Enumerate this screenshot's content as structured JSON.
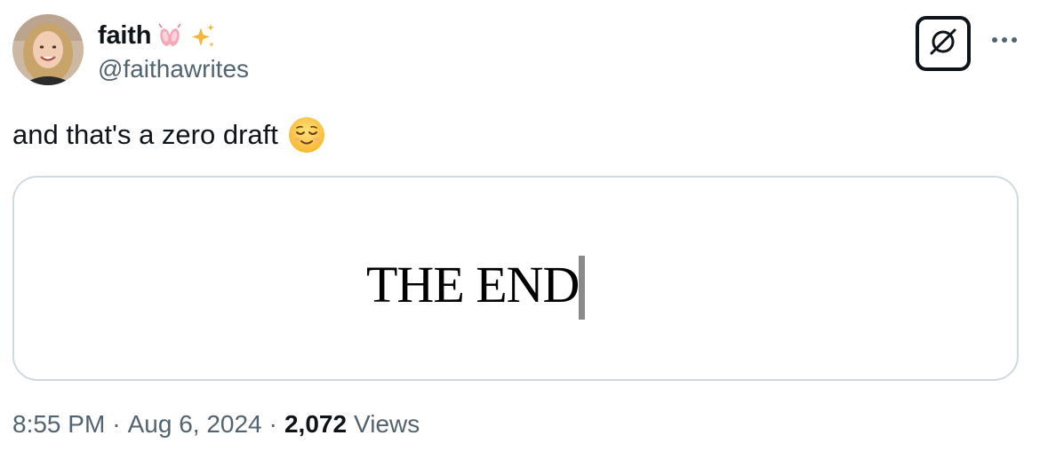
{
  "author": {
    "display_name": "faith",
    "handle": "@faithawrites",
    "name_emojis": [
      "ballet-shoes-icon",
      "sparkles-icon"
    ]
  },
  "header": {
    "grok_icon": "grok-icon",
    "more_icon": "more-options-icon"
  },
  "tweet": {
    "text": "and that's a zero draft",
    "text_emoji": "relieved-face-icon"
  },
  "media": {
    "document_text": "THE END"
  },
  "meta": {
    "time": "8:55 PM",
    "separator": "·",
    "date": "Aug 6, 2024",
    "views_count": "2,072",
    "views_label": "Views"
  },
  "colors": {
    "primary_text": "#0f1419",
    "secondary_text": "#536471",
    "border": "#cfd9de"
  }
}
